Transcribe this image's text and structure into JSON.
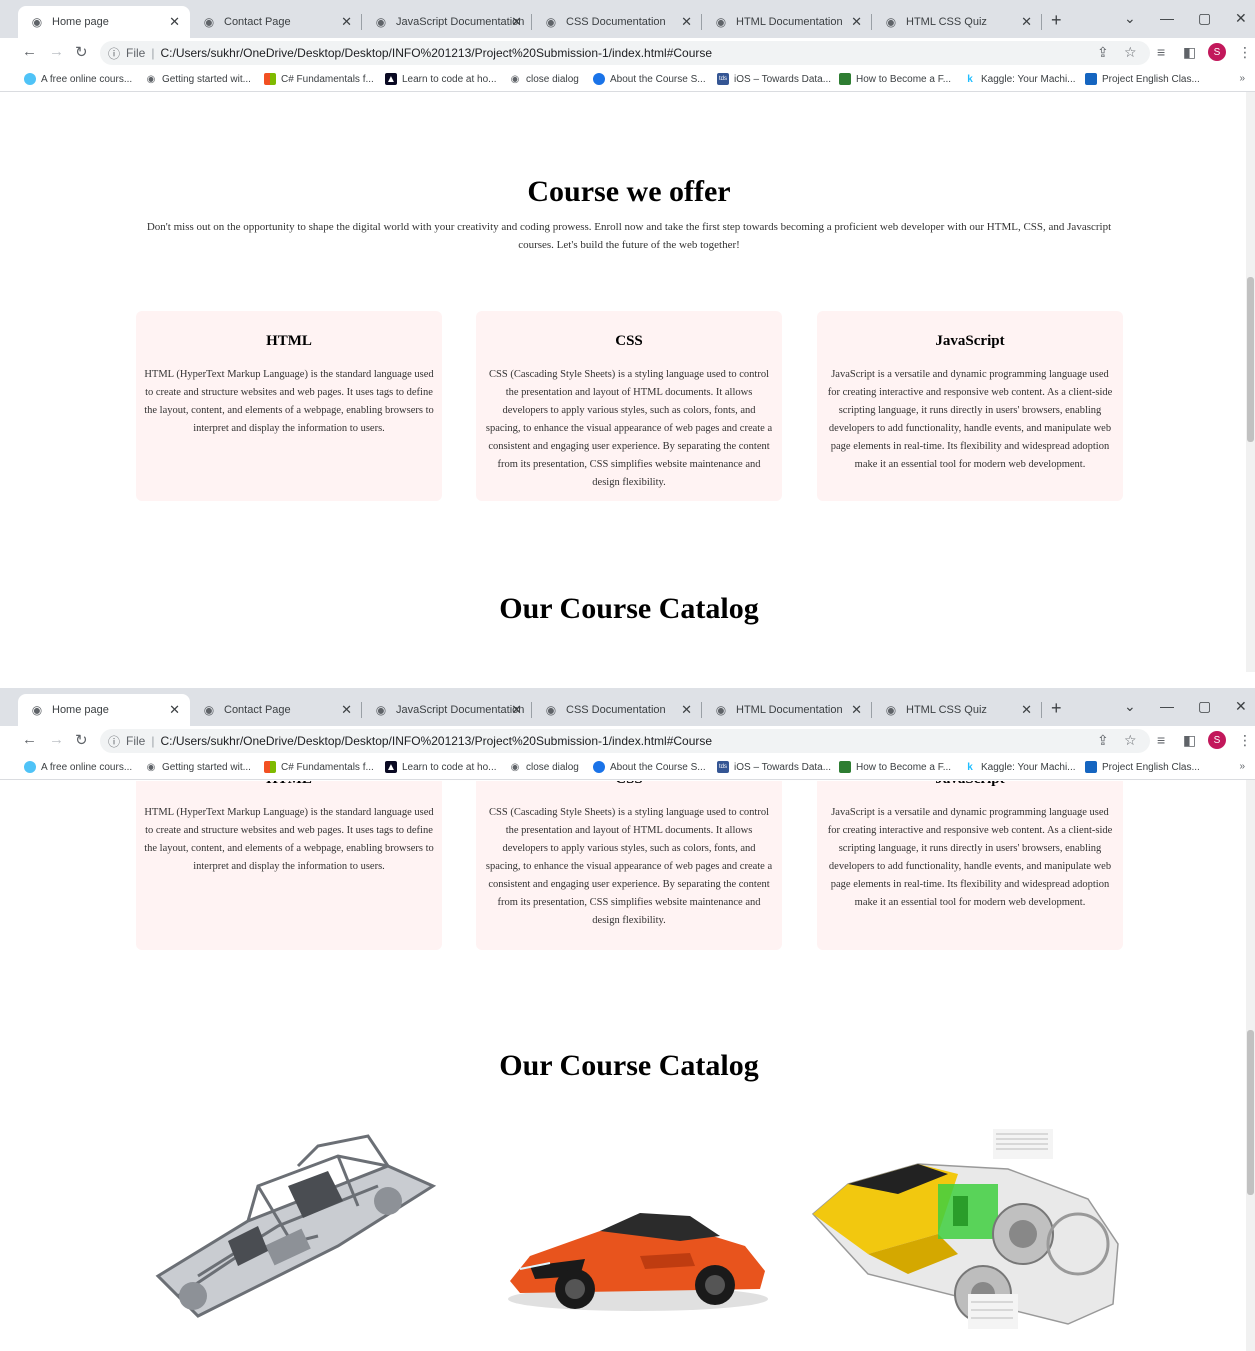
{
  "browser": {
    "tabs": [
      {
        "title": "Home page",
        "active": true
      },
      {
        "title": "Contact Page",
        "active": false
      },
      {
        "title": "JavaScript Documentation",
        "active": false
      },
      {
        "title": "CSS Documentation",
        "active": false
      },
      {
        "title": "HTML Documentation",
        "active": false
      },
      {
        "title": "HTML CSS Quiz",
        "active": false
      }
    ],
    "address": {
      "scheme_label": "File",
      "url": "C:/Users/sukhr/OneDrive/Desktop/Desktop/INFO%201213/Project%20Submission-1/index.html#Course"
    },
    "profile_initial": "S",
    "bookmarks": [
      {
        "label": "A free online cours...",
        "icon": "dot-icon",
        "color": "#4fc3f7"
      },
      {
        "label": "Getting started wit...",
        "icon": "globe-icon",
        "color": "#5f6368"
      },
      {
        "label": "C# Fundamentals f...",
        "icon": "microsoft-icon",
        "color": "#f25022"
      },
      {
        "label": "Learn to code at ho...",
        "icon": "freecodecamp-icon",
        "color": "#0a0a23"
      },
      {
        "label": "close dialog",
        "icon": "globe-icon",
        "color": "#5f6368"
      },
      {
        "label": "About the Course S...",
        "icon": "shield-icon",
        "color": "#1a73e8"
      },
      {
        "label": "iOS – Towards Data...",
        "icon": "tds-icon",
        "color": "#355694"
      },
      {
        "label": "How to Become a F...",
        "icon": "bookmark-icon",
        "color": "#2e7d32"
      },
      {
        "label": "Kaggle: Your Machi...",
        "icon": "kaggle-icon",
        "color": "#20beff"
      },
      {
        "label": "Project English Clas...",
        "icon": "book-icon",
        "color": "#1565c0"
      }
    ],
    "bookmarks_more": "»"
  },
  "courses_section": {
    "title": "Course we offer",
    "intro": "Don't miss out on the opportunity to shape the digital world with your creativity and coding prowess. Enroll now and take the first step towards becoming a proficient web developer with our HTML, CSS, and Javascript courses. Let's build the future of the web together!",
    "cards": [
      {
        "title": "HTML",
        "text": "HTML (HyperText Markup Language) is the standard language used to create and structure websites and web pages. It uses tags to define the layout, content, and elements of a webpage, enabling browsers to interpret and display the information to users."
      },
      {
        "title": "CSS",
        "text": "CSS (Cascading Style Sheets) is a styling language used to control the presentation and layout of HTML documents. It allows developers to apply various styles, such as colors, fonts, and spacing, to enhance the visual appearance of web pages and create a consistent and engaging user experience. By separating the content from its presentation, CSS simplifies website maintenance and design flexibility."
      },
      {
        "title": "JavaScript",
        "text": "JavaScript is a versatile and dynamic programming language used for creating interactive and responsive web content. As a client-side scripting language, it runs directly in users' browsers, enabling developers to add functionality, handle events, and manipulate web page elements in real-time. Its flexibility and widespread adoption make it an essential tool for modern web development."
      }
    ]
  },
  "catalog_section": {
    "title": "Our Course Catalog",
    "images": [
      "car-chassis-image",
      "orange-sports-car-image",
      "yellow-cutaway-car-image"
    ]
  }
}
